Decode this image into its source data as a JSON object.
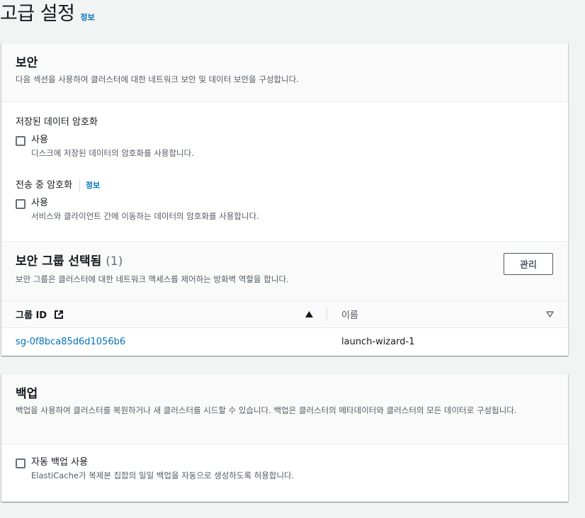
{
  "page": {
    "title": "고급 설정",
    "info_label": "정보"
  },
  "security": {
    "title": "보안",
    "description": "다음 섹션을 사용하여 클러스터에 대한 네트워크 보안 및 데이터 보안을 구성합니다.",
    "encryption_at_rest": {
      "label": "저장된 데이터 암호화",
      "checkbox_label": "사용",
      "checkbox_desc": "디스크에 저장된 데이터의 암호화를 사용합니다.",
      "checked": false
    },
    "encryption_in_transit": {
      "label": "전송 중 암호화",
      "info_label": "정보",
      "checkbox_label": "사용",
      "checkbox_desc": "서비스와 클라이언트 간에 이동하는 데이터의 암호화를 사용합니다.",
      "checked": false
    },
    "security_groups": {
      "title": "보안 그룹 선택됨",
      "count": "(1)",
      "description": "보안 그룹은 클러스터에 대한 네트워크 액세스를 제어하는 방화벽 역할을 합니다.",
      "manage_label": "관리",
      "columns": [
        "그룹 ID",
        "이름"
      ],
      "rows": [
        {
          "group_id": "sg-0f8bca85d6d1056b6",
          "name": "launch-wizard-1"
        }
      ]
    }
  },
  "backup": {
    "title": "백업",
    "description": "백업을 사용하여 클러스터를 복원하거나 새 클러스터를 시드할 수 있습니다. 백업은 클러스터의 메타데이터와 클러스터의 모든 데이터로 구성됩니다.",
    "auto_backup": {
      "checkbox_label": "자동 백업 사용",
      "checkbox_desc": "ElastiCache가 복제본 집합의 일일 백업을 자동으로 생성하도록 허용합니다.",
      "checked": false
    }
  },
  "colors": {
    "link": "#0073bb",
    "text": "#16191f",
    "muted": "#545b64",
    "background": "#f2f3f3"
  }
}
